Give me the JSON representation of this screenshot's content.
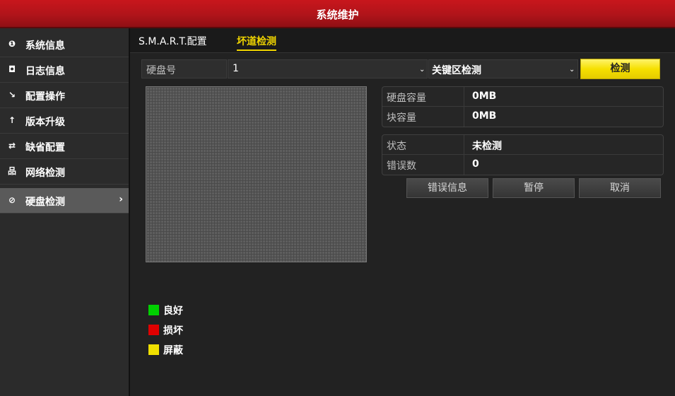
{
  "window": {
    "title": "系统维护"
  },
  "sidebar": {
    "items": [
      {
        "label": "系统信息",
        "icon": "info-icon",
        "glyph": "❶"
      },
      {
        "label": "日志信息",
        "icon": "log-icon",
        "glyph": "◘"
      },
      {
        "label": "配置操作",
        "icon": "config-icon",
        "glyph": "↘"
      },
      {
        "label": "版本升级",
        "icon": "upgrade-icon",
        "glyph": "↑"
      },
      {
        "label": "缺省配置",
        "icon": "default-icon",
        "glyph": "⇄"
      },
      {
        "label": "网络检测",
        "icon": "network-icon",
        "glyph": "品"
      },
      {
        "label": "硬盘检测",
        "icon": "disk-check-icon",
        "glyph": "⊘",
        "active": true,
        "chevron": "›"
      }
    ]
  },
  "tabs": [
    {
      "label": "S.M.A.R.T.配置"
    },
    {
      "label": "坏道检测",
      "active": true
    }
  ],
  "controls": {
    "disk_label": "硬盘号",
    "disk_value": "1",
    "mode_value": "关键区检测",
    "detect_button": "检测"
  },
  "info": {
    "capacity_label": "硬盘容量",
    "capacity_value": "0MB",
    "block_label": "块容量",
    "block_value": "0MB",
    "status_label": "状态",
    "status_value": "未检测",
    "errors_label": "错误数",
    "errors_value": "0"
  },
  "buttons": {
    "error_info": "错误信息",
    "pause": "暂停",
    "cancel": "取消"
  },
  "legend": [
    {
      "label": "良好",
      "color": "#00d000"
    },
    {
      "label": "损坏",
      "color": "#e00000"
    },
    {
      "label": "屏蔽",
      "color": "#f0e000"
    }
  ]
}
